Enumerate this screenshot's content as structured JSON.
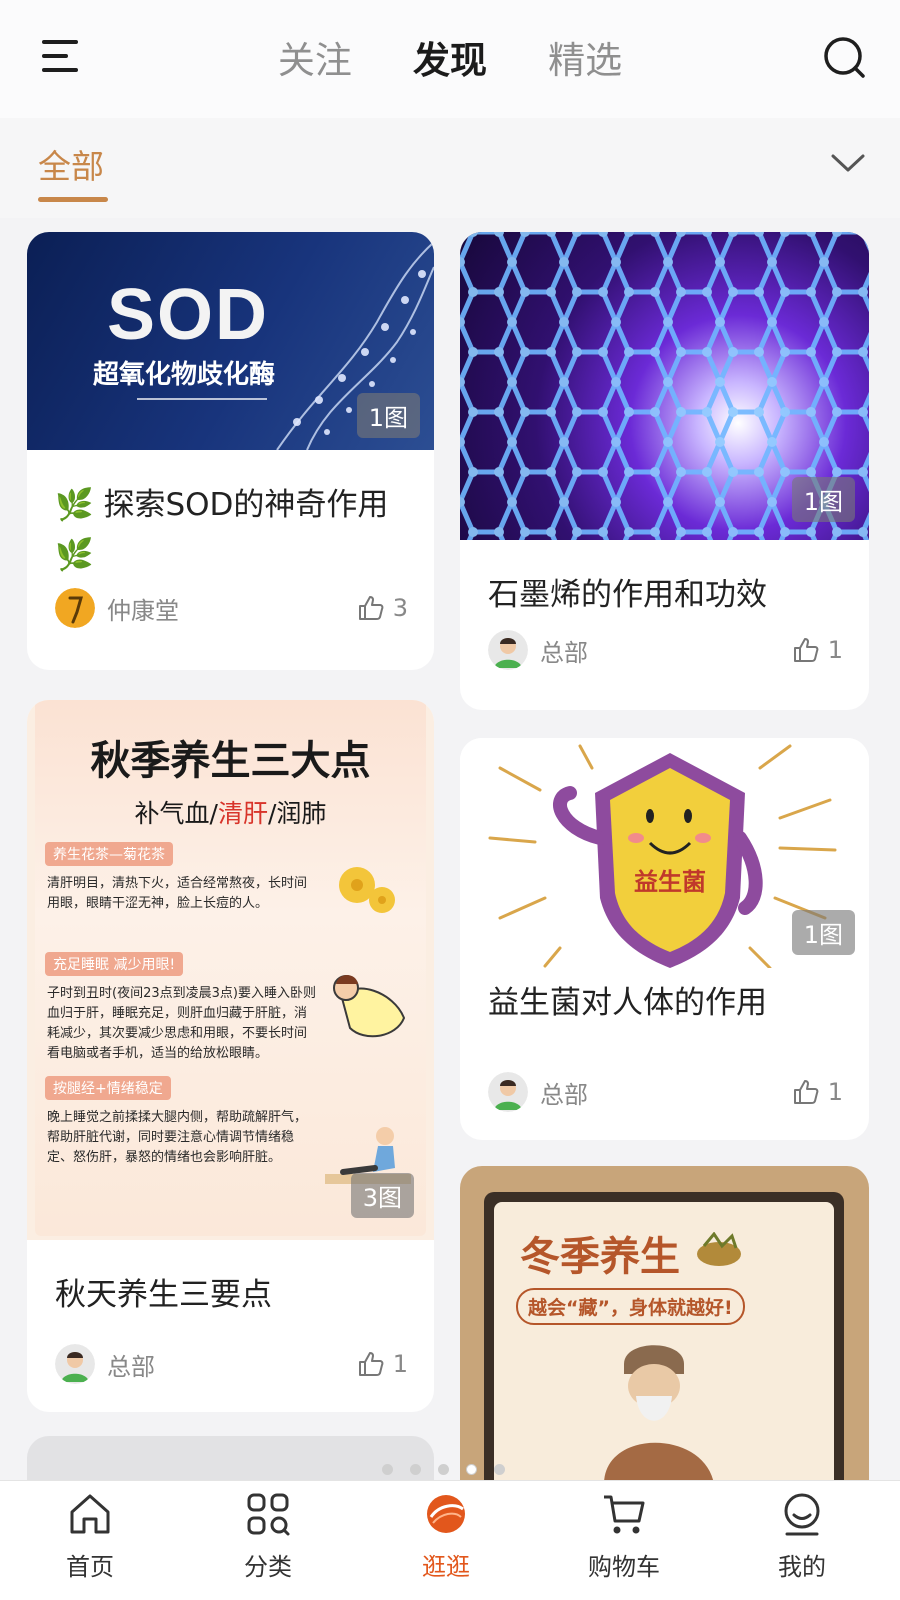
{
  "header": {
    "tabs": [
      {
        "label": "关注"
      },
      {
        "label": "发现"
      },
      {
        "label": "精选"
      }
    ]
  },
  "category": {
    "all_label": "全部",
    "accent": "#c8874a"
  },
  "cards": [
    {
      "title": "🌿 探索SOD的神奇作用 🌿",
      "image_text_main": "SOD",
      "image_text_sub": "超氧化物歧化酶",
      "badge": "1图",
      "author": "仲康堂",
      "likes": "3"
    },
    {
      "title": "石墨烯的作用和功效",
      "badge": "1图",
      "author": "总部",
      "likes": "1"
    },
    {
      "title": "秋天养生三要点",
      "badge": "3图",
      "author": "总部",
      "likes": "1",
      "poster": {
        "heading": "秋季养生三大点",
        "subheading_parts": [
          "补气血/",
          "清肝",
          "/润肺"
        ],
        "sections": [
          {
            "label": "养生花茶—菊花茶",
            "body": "清肝明目，清热下火，适合经常熬夜，长时间用眼，眼睛干涩无神，脸上长痘的人。"
          },
          {
            "label": "充足睡眠 减少用眼!",
            "body": "子时到丑时(夜间23点到凌晨3点)要入睡入卧则血归于肝，睡眠充足，则肝血归藏于肝脏，消耗减少，其次要减少思虑和用眼，不要长时间看电脑或者手机，适当的给放松眼睛。"
          },
          {
            "label": "按腿经+情绪稳定",
            "body": "晚上睡觉之前揉揉大腿内侧，帮助疏解肝气，帮助肝脏代谢，同时要注意心情调节情绪稳定、怒伤肝，暴怒的情绪也会影响肝脏。"
          }
        ]
      }
    },
    {
      "title": "益生菌对人体的作用",
      "image_text": "益生菌",
      "badge": "1图",
      "author": "总部",
      "likes": "1"
    },
    {
      "title": "",
      "image_text_main": "冬季养生",
      "image_text_sub": "越会“藏”，身体就越好!"
    }
  ],
  "bottom_nav": [
    {
      "label": "首页",
      "icon": "home-icon"
    },
    {
      "label": "分类",
      "icon": "category-grid-icon"
    },
    {
      "label": "逛逛",
      "icon": "explore-ball-icon"
    },
    {
      "label": "购物车",
      "icon": "cart-icon"
    },
    {
      "label": "我的",
      "icon": "profile-icon"
    }
  ],
  "colors": {
    "active_nav": "#e2571c",
    "text_primary": "#222222",
    "text_secondary": "#888888"
  }
}
